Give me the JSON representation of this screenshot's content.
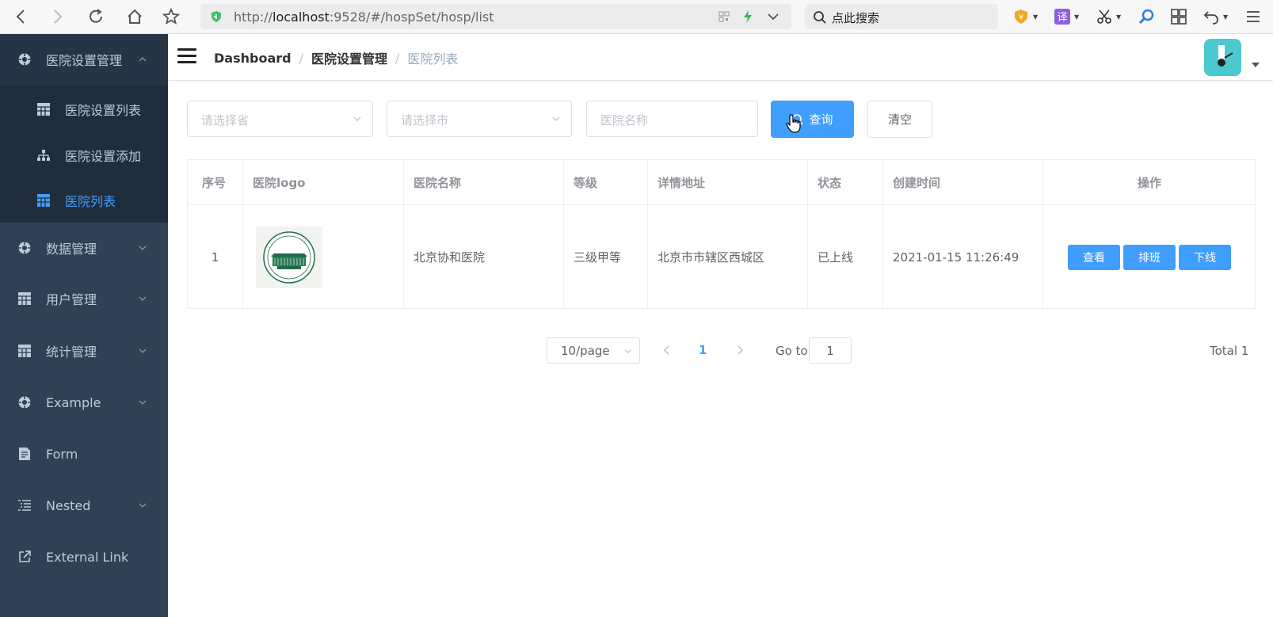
{
  "browser": {
    "url_prefix": "http://",
    "url_host": "localhost",
    "url_rest": ":9528/#/hospSet/hosp/list",
    "search_placeholder": "点此搜索"
  },
  "sidebar": {
    "groups": [
      {
        "label": "医院设置管理",
        "icon": "gear-icon",
        "expanded": true
      },
      {
        "label": "数据管理",
        "icon": "gear-icon"
      },
      {
        "label": "用户管理",
        "icon": "table-icon"
      },
      {
        "label": "统计管理",
        "icon": "table-icon"
      },
      {
        "label": "Example",
        "icon": "gear-icon"
      },
      {
        "label": "Form",
        "icon": "form-icon"
      },
      {
        "label": "Nested",
        "icon": "nested-icon"
      },
      {
        "label": "External Link",
        "icon": "external-link-icon"
      }
    ],
    "sub_items": [
      {
        "label": "医院设置列表",
        "icon": "table-icon"
      },
      {
        "label": "医院设置添加",
        "icon": "tree-icon"
      },
      {
        "label": "医院列表",
        "icon": "table-icon",
        "active": true
      }
    ]
  },
  "header": {
    "breadcrumb": [
      "Dashboard",
      "医院设置管理",
      "医院列表"
    ]
  },
  "filters": {
    "province_placeholder": "请选择省",
    "city_placeholder": "请选择市",
    "name_placeholder": "医院名称",
    "search_button": "查询",
    "clear_button": "清空"
  },
  "table": {
    "columns": [
      "序号",
      "医院logo",
      "医院名称",
      "等级",
      "详情地址",
      "状态",
      "创建时间",
      "操作"
    ],
    "rows": [
      {
        "index": "1",
        "name": "北京协和医院",
        "level": "三级甲等",
        "address": "北京市市辖区西城区",
        "status": "已上线",
        "created": "2021-01-15 11:26:49",
        "actions": [
          "查看",
          "排班",
          "下线"
        ]
      }
    ]
  },
  "pagination": {
    "page_size": "10/page",
    "current_page": "1",
    "goto_label": "Go to",
    "goto_value": "1",
    "total": "Total 1"
  },
  "colors": {
    "sidebar_bg": "#304156",
    "submenu_bg": "#1f2d3d",
    "accent": "#409eff",
    "avatar_bg": "#4cc9cf"
  }
}
